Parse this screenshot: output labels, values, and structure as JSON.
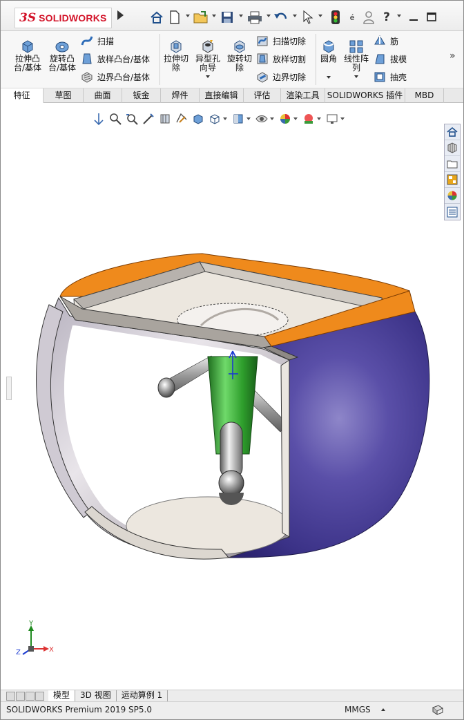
{
  "app": {
    "brand": "SOLIDWORKS",
    "logo_mark": "3S",
    "quick_access": [
      "home-icon",
      "new-document-icon",
      "open-icon",
      "save-icon",
      "print-icon",
      "undo-icon",
      "select-icon",
      "rebuild-icon",
      "options-icon",
      "user-icon",
      "help-icon",
      "minimize-icon",
      "maximize-icon"
    ],
    "quick_access_text": {
      "options": "é",
      "help": "?"
    }
  },
  "ribbon": {
    "extrude_boss": "拉伸凸\n台/基体",
    "revolve_boss": "旋转凸\n台/基体",
    "sweep": "扫描",
    "loft_boss": "放样凸台/基体",
    "boundary_boss": "边界凸台/基体",
    "extrude_cut": "拉伸切\n除",
    "hole_wizard": "异型孔\n向导",
    "revolve_cut": "旋转切\n除",
    "sweep_cut": "扫描切除",
    "loft_cut": "放样切割",
    "boundary_cut": "边界切除",
    "fillet": "圆角",
    "linear_pattern": "线性阵\n列",
    "rib": "筋",
    "draft": "拔模",
    "shell": "抽壳",
    "more": "»"
  },
  "tabs": [
    {
      "label": "特征",
      "active": true
    },
    {
      "label": "草图",
      "active": false
    },
    {
      "label": "曲面",
      "active": false
    },
    {
      "label": "钣金",
      "active": false
    },
    {
      "label": "焊件",
      "active": false
    },
    {
      "label": "直接编辑",
      "active": false
    },
    {
      "label": "评估",
      "active": false
    },
    {
      "label": "渲染工具",
      "active": false
    },
    {
      "label": "SOLIDWORKS 插件",
      "active": false
    },
    {
      "label": "MBD",
      "active": false
    }
  ],
  "heads_up_toolbar": [
    "zoom-to-fit-icon",
    "zoom-area-icon",
    "previous-view-icon",
    "section-view-icon",
    "dynamic-annotation-icon",
    "view-orientation-icon",
    "display-style-icon",
    "hide-show-icon",
    "edit-appearance-icon",
    "apply-scene-icon",
    "view-settings-icon"
  ],
  "task_pane": [
    "home-icon",
    "design-library-icon",
    "file-explorer-icon",
    "view-palette-icon",
    "appearances-icon",
    "custom-properties-icon"
  ],
  "triad": {
    "x": "X",
    "y": "Y",
    "z": "Z"
  },
  "model_tabs": [
    {
      "label": "模型",
      "active": true
    },
    {
      "label": "3D 视图",
      "active": false
    },
    {
      "label": "运动算例 1",
      "active": false
    }
  ],
  "status": {
    "product": "SOLIDWORKS Premium 2019 SP5.0",
    "units": "MMGS"
  },
  "colors": {
    "rim": "#ef8a1c",
    "shell_outer": "#4b3f92",
    "shaft": "#2e9e2c",
    "metal": "#b9b9b9",
    "floor": "#ece7df"
  }
}
